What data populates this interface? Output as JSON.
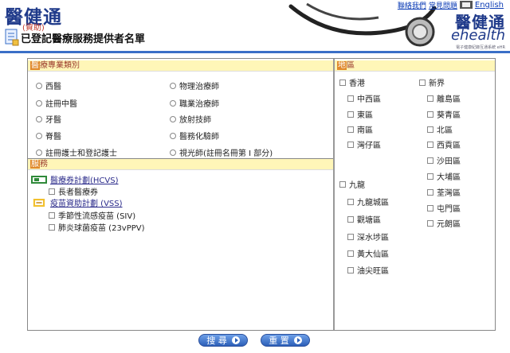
{
  "header": {
    "logo_title": "醫健通",
    "logo_subtitle": "(資助)",
    "page_heading": "已登記醫療服務提供者名單",
    "top_links": [
      "聯絡我們",
      "常見問題"
    ],
    "language_link": "English",
    "ehealth_cn": "醫健通",
    "ehealth_en": "ehealth",
    "ehealth_tiny": "電子健康紀錄互通系統 eHR"
  },
  "professions": {
    "section_title_cap": "醫",
    "section_title_rest": "療專業類別",
    "items": [
      {
        "label": "西醫"
      },
      {
        "label": "物理治療師"
      },
      {
        "label": "註冊中醫"
      },
      {
        "label": "職業治療師"
      },
      {
        "label": "牙醫"
      },
      {
        "label": "放射技師"
      },
      {
        "label": "脊醫"
      },
      {
        "label": "醫務化驗師"
      },
      {
        "label": "註冊護士和登記護士"
      },
      {
        "label": "視光師(註冊名冊第 I 部分)"
      }
    ]
  },
  "services": {
    "section_title_cap": "服",
    "section_title_rest": "務",
    "hcvs_title": "醫療券計劃(HCVS)",
    "hcvs_items": [
      "長者醫療券"
    ],
    "vss_title": "疫苗資助計劃 (VSS)",
    "vss_items": [
      "季節性流感疫苗 (SIV)",
      "肺炎球菌疫苗 (23vPPV)"
    ]
  },
  "districts": {
    "section_title_cap": "地",
    "section_title_rest": "區",
    "hk_island": "香港",
    "hk_items": [
      "中西區",
      "東區",
      "南區",
      "灣仔區"
    ],
    "nt": "新界",
    "nt_items": [
      "離島區",
      "葵青區",
      "北區",
      "西貢區",
      "沙田區",
      "大埔區",
      "荃灣區",
      "屯門區",
      "元朗區"
    ],
    "kowloon": "九龍",
    "kln_items": [
      "九龍城區",
      "觀塘區",
      "深水埗區",
      "黃大仙區",
      "油尖旺區"
    ]
  },
  "buttons": {
    "search": "搜 尋",
    "reset": "重 置"
  }
}
